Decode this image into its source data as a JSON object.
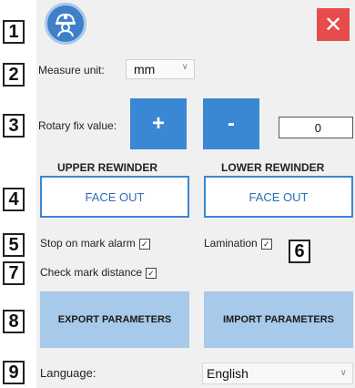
{
  "callouts": [
    "1",
    "2",
    "3",
    "4",
    "5",
    "6",
    "7",
    "8",
    "9"
  ],
  "header": {
    "avatar_icon": "engineer-helmet-icon",
    "close_label": "✕"
  },
  "measure": {
    "label": "Measure unit:",
    "value": "mm"
  },
  "rotary": {
    "label": "Rotary fix value:",
    "plus": "+",
    "minus": "-",
    "value": "0"
  },
  "rewinders": {
    "upper_heading": "UPPER REWINDER",
    "lower_heading": "LOWER REWINDER",
    "upper_button": "FACE OUT",
    "lower_button": "FACE OUT"
  },
  "options": {
    "stop_on_mark": "Stop on mark alarm",
    "lamination": "Lamination",
    "check_mark": "Check mark distance"
  },
  "params": {
    "export": "EXPORT PARAMETERS",
    "import": "IMPORT PARAMETERS"
  },
  "language": {
    "label": "Language:",
    "value": "English"
  },
  "colors": {
    "accent": "#3a87d3",
    "light_accent": "#a7c9ea",
    "close": "#e74c4c",
    "panel": "#f0f0f0"
  }
}
